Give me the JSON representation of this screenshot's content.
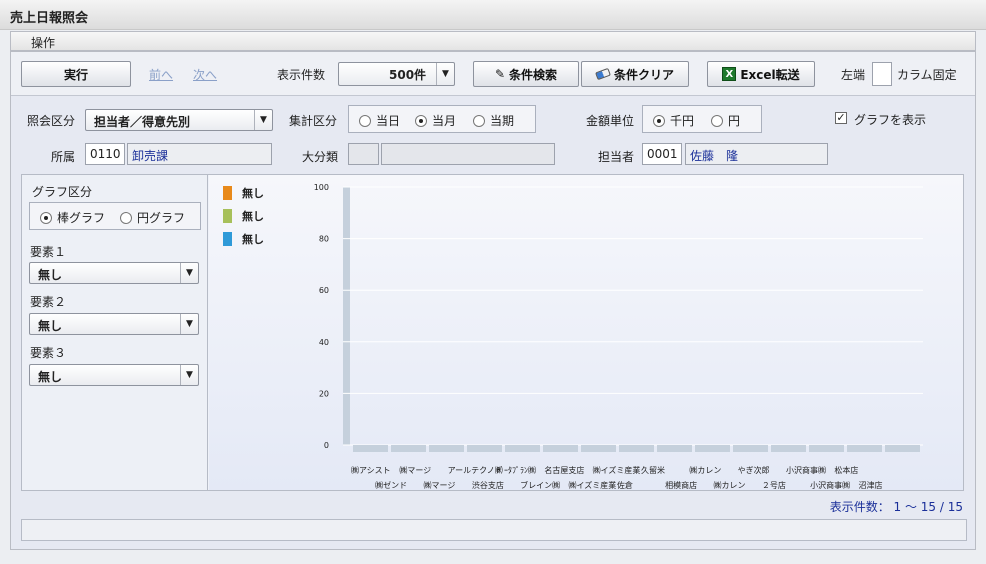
{
  "window": {
    "title": "売上日報照会"
  },
  "menubar": {
    "operation": "操作"
  },
  "toolbar": {
    "run": "実行",
    "prev": "前へ",
    "next": "次へ",
    "display_count_label": "表示件数",
    "display_count_value": "500件",
    "search_condition": "条件検索",
    "clear_condition": "条件クリア",
    "excel_export": "Excel転送",
    "left_edge_label": "左端",
    "column_fix_label": "カラム固定"
  },
  "filters": {
    "inquiry_type_label": "照会区分",
    "inquiry_type_value": "担当者／得意先別",
    "aggregate_label": "集計区分",
    "aggregate_options": [
      "当日",
      "当月",
      "当期"
    ],
    "aggregate_selected": "当月",
    "amount_unit_label": "金額単位",
    "amount_unit_options": [
      "千円",
      "円"
    ],
    "amount_unit_selected": "千円",
    "show_graph_label": "グラフを表示",
    "show_graph_checked": true,
    "dept_label": "所属",
    "dept_code": "0110",
    "dept_name": "卸売課",
    "category_label": "大分類",
    "category_code": "",
    "category_name": "",
    "staff_label": "担当者",
    "staff_code": "0001",
    "staff_name": "佐藤　隆"
  },
  "graph_settings": {
    "graph_type_label": "グラフ区分",
    "graph_type_options": [
      "棒グラフ",
      "円グラフ"
    ],
    "graph_type_selected": "棒グラフ",
    "element1_label": "要素１",
    "element1_value": "無し",
    "element2_label": "要素２",
    "element2_value": "無し",
    "element3_label": "要素３",
    "element3_value": "無し"
  },
  "legend": [
    {
      "label": "無し",
      "color": "#e8891a"
    },
    {
      "label": "無し",
      "color": "#a7c05a"
    },
    {
      "label": "無し",
      "color": "#2f9ad8"
    }
  ],
  "chart_data": {
    "type": "bar",
    "ylim": [
      0,
      100
    ],
    "y_ticks": [
      0,
      20,
      40,
      60,
      80,
      100
    ],
    "categories": [
      "㈱アシスト",
      "㈱ゼンド",
      "㈱マージ",
      "㈱マージ",
      "アールテクノ㈱",
      "渋谷支店",
      "ﾃﾞｰﾀﾌﾟﾗﾝ㈱",
      "ブレイン㈱",
      "名古屋支店",
      "㈱イズミ産業",
      "㈱イズミ産業",
      "佐倉",
      "久留米",
      "相模商店",
      "㈱カレン"
    ],
    "values": [
      0,
      0,
      0,
      0,
      0,
      0,
      0,
      0,
      0,
      0,
      0,
      0,
      0,
      0,
      0
    ],
    "extra_x_labels": [
      "㈱カレン",
      "やぎ次郎",
      "２号店",
      "小沢商事㈱",
      "小沢商事㈱",
      "松本店",
      "沼津店"
    ],
    "bar_color": "#c5d0dc"
  },
  "footer": {
    "count_text": "表示件数： 1 ～ 15 / 15"
  }
}
